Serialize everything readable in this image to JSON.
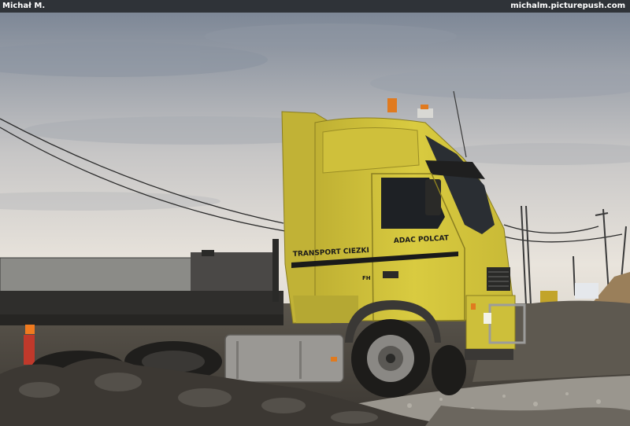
{
  "watermark": {
    "author": "Michał M.",
    "site": "michalm.picturepush.com"
  },
  "truck": {
    "side_text_main": "TRANSPORT CIEZKI",
    "side_text_company": "ADAC POLCAT",
    "model_badge": "FH",
    "colors": {
      "cab_yellow": "#d9c93c",
      "stripe": "#1a1a1a",
      "trailer": "#5a5a58"
    }
  },
  "scene_colors": {
    "sky_top": "#7d8796",
    "sky_mid": "#c7c6c6",
    "sky_horizon": "#e9e4dc",
    "ground": "#4a4640",
    "gravel": "#9a968e"
  }
}
